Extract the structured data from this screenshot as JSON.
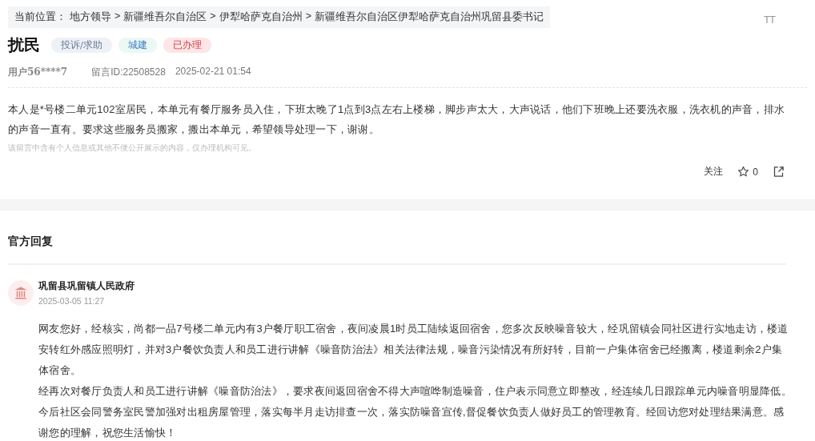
{
  "breadcrumb": {
    "label": "当前位置：",
    "items": [
      "地方领导",
      "新疆维吾尔自治区",
      "伊犁哈萨克自治州",
      "新疆维吾尔自治区伊犁哈萨克自治州巩留县委书记"
    ],
    "separator": ">"
  },
  "text_size_button": "TT",
  "message": {
    "title": "扰民",
    "tags": [
      {
        "label": "投诉/求助",
        "kind": "type"
      },
      {
        "label": "城建",
        "kind": "category"
      },
      {
        "label": "已办理",
        "kind": "status"
      }
    ],
    "user": "用户56****7",
    "message_id": "留言ID:22508528",
    "time": "2025-02-21 01:54",
    "body": "本人是*号楼二单元102室居民，本单元有餐厅服务员入住，下班太晚了1点到3点左右上楼梯，脚步声太大，大声说话，他们下班晚上还要洗衣服，洗衣机的声音，排水的声音一直有。要求这些服务员搬家，搬出本单元，希望领导处理一下，谢谢。",
    "privacy_note": "该留言中含有个人信息或其他不便公开展示的内容，仅办理机构可见。",
    "follow_label": "关注",
    "like_count": "0"
  },
  "official_reply": {
    "heading": "官方回复",
    "org": "巩留县巩留镇人民政府",
    "time": "2025-03-05 11:27",
    "paragraphs": [
      "网友您好，经核实，尚都一品7号楼二单元内有3户餐厅职工宿舍，夜间凌晨1时员工陆续返回宿舍，您多次反映噪音较大，经巩留镇会同社区进行实地走访，楼道安转红外感应照明灯，并对3户餐饮负责人和员工进行讲解《噪音防治法》相关法律法规，噪音污染情况有所好转，目前一户集体宿舍已经搬离，楼道剩余2户集体宿舍。",
      "经再次对餐厅负责人和员工进行讲解《噪音防治法》，要求夜间返回宿舍不得大声喧哗制造噪音，住户表示同意立即整改，经连续几日跟踪单元内噪音明显降低。今后社区会同警务室民警加强对出租房屋管理，落实每半月走访排查一次，落实防噪音宣传,督促餐饮负责人做好员工的管理教育。经回访您对处理结果满意。感谢您的理解，祝您生活愉快！"
    ]
  }
}
